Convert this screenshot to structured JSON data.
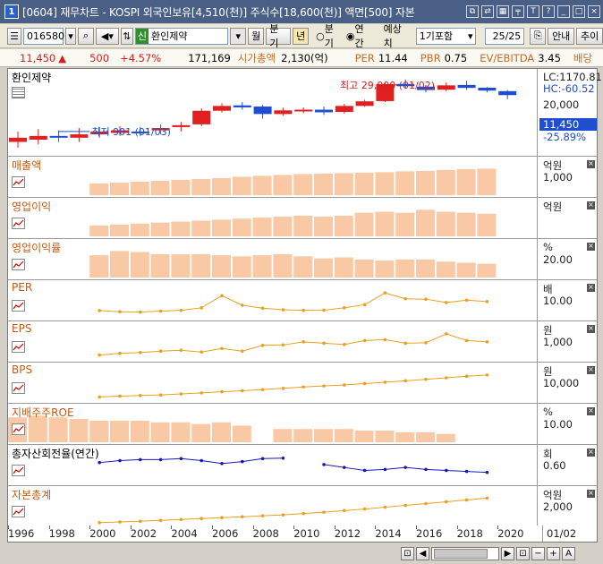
{
  "window": {
    "number": "1",
    "title": "[0604] 재무차트 - KOSPI 외국인보유[4,510(천)] 주식수[18,600(천)] 액면[500] 자본",
    "icons": [
      "restore-icon",
      "link-icon",
      "tile-icon",
      "pin-icon",
      "font-icon",
      "help-icon",
      "minimize-icon",
      "maximize-icon",
      "close-icon"
    ]
  },
  "toolbar": {
    "code": "016580",
    "badge": "신",
    "stock_name": "환인제약",
    "period_month": "월",
    "period_quarter": "분기",
    "period_year": "년",
    "radio_quarter": "분기",
    "radio_annual": "연간",
    "estimate_label": "예상치",
    "estimate_select": "1기포함",
    "page": "25",
    "page_total": "/25",
    "guide_label": "안내",
    "add_label": "추이"
  },
  "price": {
    "current": "11,450",
    "change": "500",
    "rate": "+4.57%",
    "volume": "171,169",
    "mcap_label": "시가총액",
    "mcap_value": "2,130(억)",
    "per_label": "PER",
    "per_value": "11.44",
    "pbr_label": "PBR",
    "pbr_value": "0.75",
    "ev_label": "EV/EBITDA",
    "ev_value": "3.45",
    "div_label": "배당"
  },
  "price_panel": {
    "title": "환인제약",
    "lc": "LC:1170.81",
    "hc": "HC:-60.52",
    "tick": "20,000",
    "current_box": "11,450",
    "current_pct": "-25.89%",
    "high_annotation": "최고 29,000 (01/02)",
    "low_annotation": "최저 901 (01/03)"
  },
  "colors": {
    "up": "#e02020",
    "down": "#1f4fd0",
    "bar": "#f8c9a4",
    "line": "#e8a020",
    "blue_line": "#1818b8"
  },
  "chart_data": {
    "type": "bar",
    "x": [
      "1996",
      "1997",
      "1998",
      "1999",
      "2000",
      "2001",
      "2002",
      "2003",
      "2004",
      "2005",
      "2006",
      "2007",
      "2008",
      "2009",
      "2010",
      "2011",
      "2012",
      "2013",
      "2014",
      "2015",
      "2016",
      "2017",
      "2018",
      "2019",
      "2020"
    ],
    "candles": [
      {
        "year": "1996",
        "open": 700,
        "close": 900,
        "low": 500,
        "high": 1300
      },
      {
        "year": "1997",
        "open": 800,
        "close": 1000,
        "low": 600,
        "high": 1500
      },
      {
        "year": "1998",
        "open": 1000,
        "close": 900,
        "low": 700,
        "high": 1400
      },
      {
        "year": "1999",
        "open": 900,
        "close": 1100,
        "low": 700,
        "high": 1600
      },
      {
        "year": "2000",
        "open": 1100,
        "close": 1300,
        "low": 900,
        "high": 1700
      },
      {
        "year": "2001",
        "open": 1200,
        "close": 1400,
        "low": 1000,
        "high": 1800
      },
      {
        "year": "2002",
        "open": 1300,
        "close": 1200,
        "low": 1000,
        "high": 1700
      },
      {
        "year": "2003",
        "open": 1400,
        "close": 1600,
        "low": 1100,
        "high": 2000
      },
      {
        "year": "2004",
        "open": 1700,
        "close": 1900,
        "low": 1300,
        "high": 2300
      },
      {
        "year": "2005",
        "open": 2000,
        "close": 4500,
        "low": 1800,
        "high": 5200
      },
      {
        "year": "2006",
        "open": 4500,
        "close": 6000,
        "low": 4000,
        "high": 7000
      },
      {
        "year": "2007",
        "open": 6200,
        "close": 5500,
        "low": 4800,
        "high": 7500
      },
      {
        "year": "2008",
        "open": 5800,
        "close": 3700,
        "low": 2800,
        "high": 6400
      },
      {
        "year": "2009",
        "open": 3700,
        "close": 4600,
        "low": 3300,
        "high": 5400
      },
      {
        "year": "2010",
        "open": 4400,
        "close": 4800,
        "low": 3900,
        "high": 5500
      },
      {
        "year": "2011",
        "open": 4800,
        "close": 4100,
        "low": 3500,
        "high": 5800
      },
      {
        "year": "2012",
        "open": 4200,
        "close": 6000,
        "low": 3800,
        "high": 6800
      },
      {
        "year": "2013",
        "open": 6000,
        "close": 7900,
        "low": 5700,
        "high": 8700
      },
      {
        "year": "2014",
        "open": 8000,
        "close": 22000,
        "low": 7500,
        "high": 24000
      },
      {
        "year": "2015",
        "open": 22300,
        "close": 19500,
        "low": 17500,
        "high": 29000
      },
      {
        "year": "2016",
        "open": 19000,
        "close": 15500,
        "low": 13500,
        "high": 21000
      },
      {
        "year": "2017",
        "open": 15800,
        "close": 20500,
        "low": 14500,
        "high": 24500
      },
      {
        "year": "2018",
        "open": 21000,
        "close": 17600,
        "low": 15500,
        "high": 27000
      },
      {
        "year": "2019",
        "open": 17800,
        "close": 15000,
        "low": 13500,
        "high": 18500
      },
      {
        "year": "2020",
        "open": 14500,
        "close": 11450,
        "low": 9000,
        "high": 15500
      }
    ],
    "panels": [
      {
        "title": "매출액",
        "unit": "억원",
        "tick": "1,000",
        "kind": "bar",
        "color": "#c45a10",
        "start": "2000",
        "values": [
          520,
          560,
          600,
          640,
          680,
          720,
          760,
          820,
          860,
          900,
          940,
          960,
          980,
          1000,
          1020,
          1060,
          1080,
          1120,
          1160,
          1180
        ]
      },
      {
        "title": "영업이익",
        "unit": "억원",
        "tick": "",
        "kind": "bar",
        "color": "#c45a10",
        "start": "2000",
        "values": [
          110,
          120,
          130,
          140,
          150,
          160,
          170,
          180,
          190,
          200,
          210,
          200,
          210,
          240,
          250,
          240,
          270,
          250,
          240,
          230
        ]
      },
      {
        "title": "영업이익률",
        "unit": "%",
        "tick": "20.00",
        "kind": "bar",
        "color": "#c45a10",
        "start": "2000",
        "values": [
          21,
          25,
          24,
          22,
          22,
          22,
          21,
          20,
          21,
          22,
          20,
          18,
          19,
          17,
          16,
          17,
          17,
          15,
          14,
          13
        ]
      },
      {
        "title": "PER",
        "unit": "배",
        "tick": "10.00",
        "kind": "line",
        "color": "#c45a10",
        "start": "2000",
        "values": [
          9.2,
          8.6,
          8.4,
          8.9,
          9.3,
          10.6,
          16.8,
          11.9,
          10.4,
          9.6,
          9.3,
          9.4,
          10.6,
          12.2,
          18.2,
          15.2,
          15.0,
          13.3,
          14.5,
          13.8
        ]
      },
      {
        "title": "EPS",
        "unit": "원",
        "tick": "1,000",
        "kind": "line",
        "color": "#c45a10",
        "start": "2000",
        "values": [
          540,
          620,
          660,
          720,
          760,
          680,
          840,
          720,
          980,
          1000,
          1140,
          1080,
          1020,
          1200,
          1240,
          1080,
          1100,
          1500,
          1200,
          1140
        ]
      },
      {
        "title": "BPS",
        "unit": "원",
        "tick": "10,000",
        "kind": "line",
        "color": "#c45a10",
        "start": "2000",
        "values": [
          5200,
          5600,
          5900,
          6200,
          6700,
          7200,
          7800,
          8300,
          8900,
          9500,
          10200,
          10700,
          11200,
          11900,
          12600,
          13300,
          14000,
          14800,
          15600,
          16200
        ]
      },
      {
        "title": "지배주주ROE",
        "unit": "%",
        "tick": "10.00",
        "kind": "bar",
        "color": "#c45a10",
        "start": "1996",
        "values": [
          15,
          16,
          15,
          14,
          13,
          13,
          13,
          12,
          12,
          11,
          12,
          10,
          null,
          8,
          8,
          8,
          8,
          7,
          7,
          6,
          6,
          5
        ]
      },
      {
        "title": "총자산회전율(연간)",
        "unit": "회",
        "tick": "0.60",
        "kind": "line",
        "color": "#1818b8",
        "start": "2000",
        "values": [
          0.76,
          0.8,
          0.82,
          0.82,
          0.84,
          0.8,
          0.74,
          0.78,
          0.84,
          0.85,
          null,
          0.72,
          0.66,
          0.6,
          0.62,
          0.66,
          0.62,
          0.6,
          0.58,
          0.56
        ]
      },
      {
        "title": "자본총계",
        "unit": "억원",
        "tick": "2,000",
        "kind": "line",
        "color": "#c45a10",
        "start": "2000",
        "values": [
          120,
          150,
          180,
          220,
          260,
          300,
          340,
          380,
          420,
          460,
          520,
          580,
          650,
          720,
          800,
          880,
          960,
          1040,
          1120,
          1200
        ]
      }
    ],
    "xlabels": [
      "1996",
      "1998",
      "2000",
      "2002",
      "2004",
      "2006",
      "2008",
      "2010",
      "2012",
      "2014",
      "2016",
      "2018",
      "2020"
    ],
    "date_label": "01/02"
  }
}
